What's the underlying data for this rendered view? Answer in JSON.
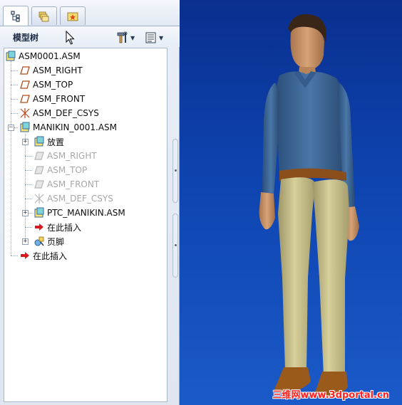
{
  "tabs": [
    {
      "name": "model-tree-tab",
      "icon": "tree-structure-icon",
      "active": true
    },
    {
      "name": "folder-browser-tab",
      "icon": "folders-icon",
      "active": false
    },
    {
      "name": "favorites-tab",
      "icon": "star-folder-icon",
      "active": false
    }
  ],
  "panel": {
    "title": "模型树",
    "settings_icon": "tools-icon",
    "show_icon": "list-view-icon"
  },
  "tree": {
    "root": "ASM0001.ASM",
    "asm_right": "ASM_RIGHT",
    "asm_top": "ASM_TOP",
    "asm_front": "ASM_FRONT",
    "asm_def_csys": "ASM_DEF_CSYS",
    "manikin": "MANIKIN_0001.ASM",
    "placement": "放置",
    "sub_right": "ASM_RIGHT",
    "sub_top": "ASM_TOP",
    "sub_front": "ASM_FRONT",
    "sub_csys": "ASM_DEF_CSYS",
    "ptc_manikin": "PTC_MANIKIN.ASM",
    "insert_here_inner": "在此插入",
    "footer": "页脚",
    "insert_here_outer": "在此插入"
  },
  "viewport": {
    "background_top": "#0a2f8f",
    "background_bottom": "#1a5ac8",
    "shirt_color": "#3e6a9a",
    "pants_color": "#cbc38d",
    "shoe_color": "#9a5a1c"
  },
  "watermark": "三维网www.3dportal.cn"
}
